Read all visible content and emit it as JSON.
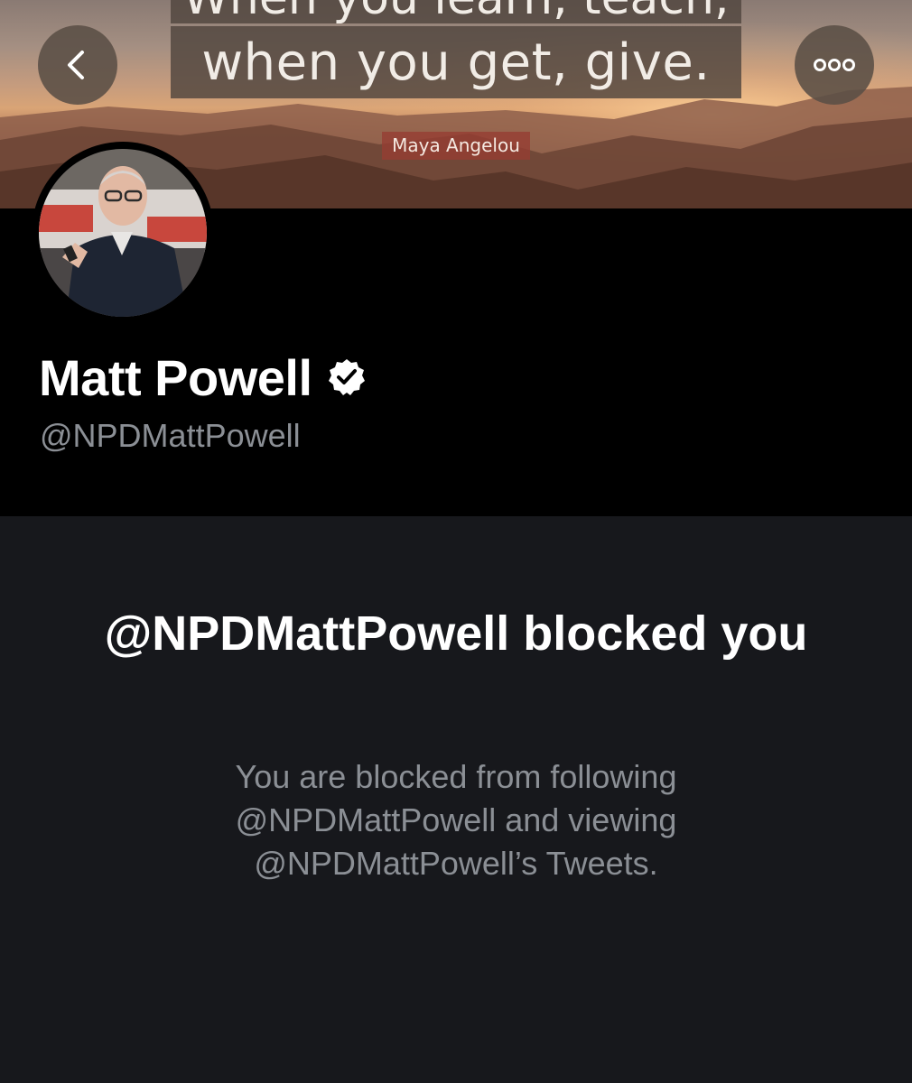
{
  "header": {
    "quote_line_1": "When you learn, teach,",
    "quote_line_2": "when you get, give.",
    "quote_attribution": "Maya Angelou",
    "back_icon": "chevron-left-icon",
    "more_icon": "more-horizontal-icon"
  },
  "profile": {
    "display_name": "Matt Powell",
    "verified_icon": "verified-badge-icon",
    "handle": "@NPDMattPowell"
  },
  "blocked": {
    "title": "@NPDMattPowell blocked you",
    "description": "You are blocked from following @NPDMattPowell and viewing @NPDMattPowell’s Tweets."
  },
  "colors": {
    "page_background": "#000000",
    "panel_background": "#17181c",
    "primary_text": "#ffffff",
    "secondary_text": "#8b8f95"
  }
}
